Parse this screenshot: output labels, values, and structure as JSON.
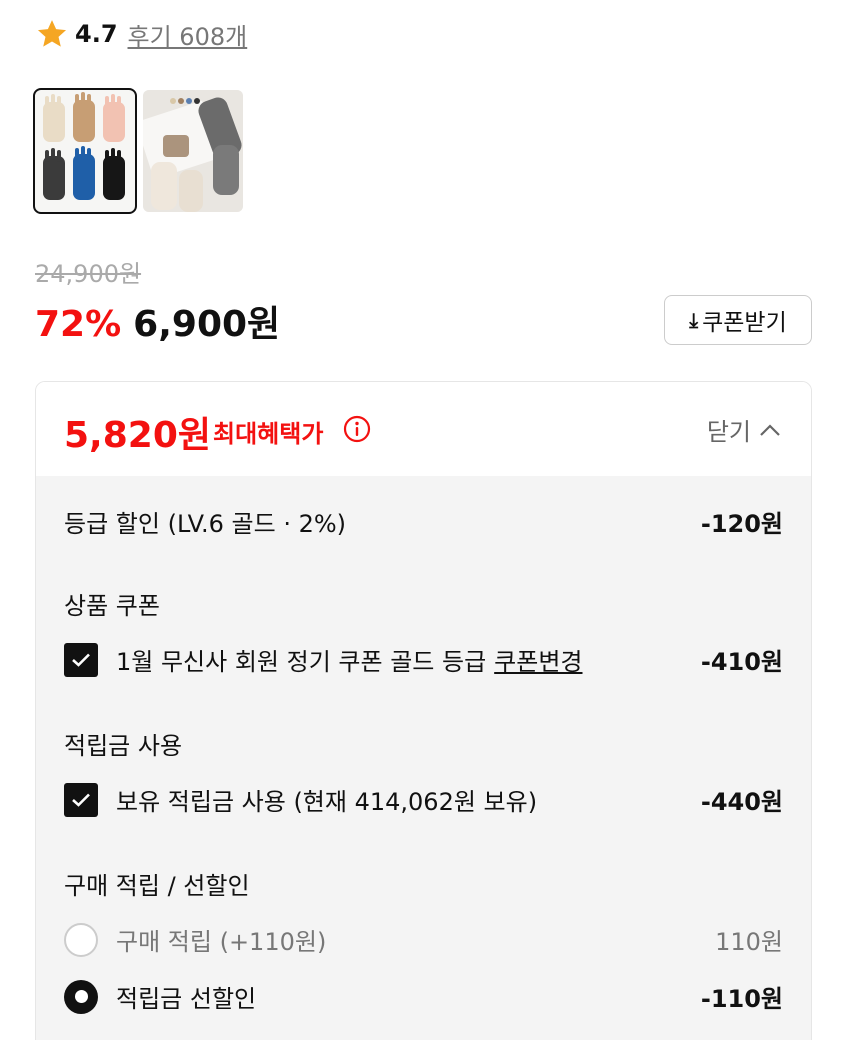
{
  "rating": {
    "value": "4.7",
    "review_link": "후기 608개",
    "star_color": "#f5a623"
  },
  "thumbnails": [
    {
      "name": "gloves-colors-thumb",
      "selected": true
    },
    {
      "name": "gloves-lifestyle-thumb",
      "selected": false
    }
  ],
  "price": {
    "original": "24,900원",
    "discount": "72%",
    "sale": "6,900원",
    "accent_color": "#f31110"
  },
  "coupon_button": {
    "icon": "download-icon",
    "label": "쿠폰받기"
  },
  "benefit": {
    "max_price": "5,820원",
    "max_label": "최대혜택가",
    "toggle_label": "닫기",
    "grade_discount": {
      "label": "등급 할인 (LV.6 골드 · 2%)",
      "amount": "-120원"
    },
    "product_coupon": {
      "title": "상품 쿠폰",
      "item_label": "1월 무신사 회원 정기 쿠폰 골드 등급",
      "change_link": "쿠폰변경",
      "amount": "-410원",
      "checked": true
    },
    "points_use": {
      "title": "적립금 사용",
      "item_label": "보유 적립금 사용 (현재 414,062원 보유)",
      "amount": "-440원",
      "checked": true
    },
    "purchase_reward": {
      "title": "구매 적립 / 선할인",
      "options": [
        {
          "label": "구매 적립 (+110원)",
          "amount": "110원",
          "selected": false
        },
        {
          "label": "적립금 선할인",
          "amount": "-110원",
          "selected": true
        }
      ]
    }
  }
}
